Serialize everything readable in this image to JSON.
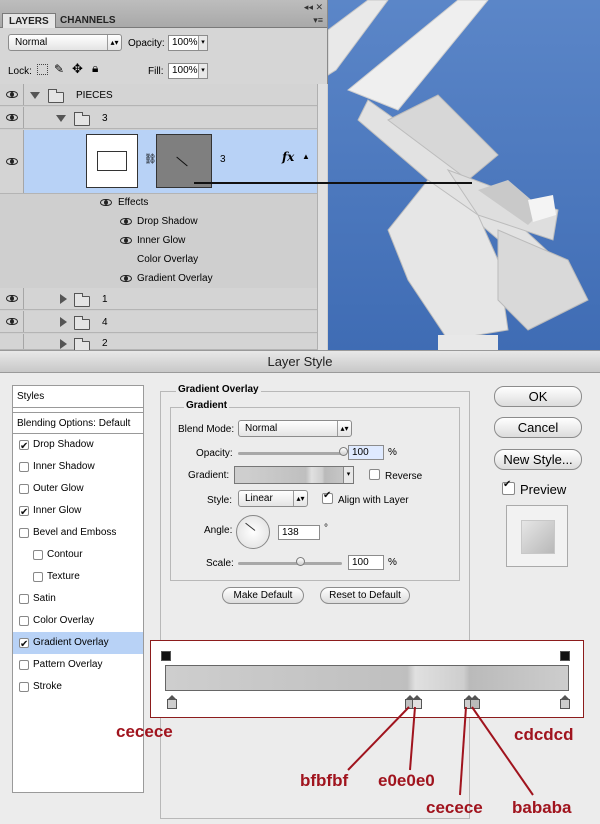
{
  "layers_panel": {
    "tabs": [
      "LAYERS",
      "CHANNELS"
    ],
    "controls": "◂◂ ✕",
    "menu": "▾≡",
    "blend_mode": "Normal",
    "opacity_label": "Opacity:",
    "opacity_value": "100%",
    "lock_label": "Lock:",
    "fill_label": "Fill:",
    "fill_value": "100%",
    "rows": [
      {
        "name": "PIECES"
      },
      {
        "name": "3"
      },
      {
        "name": "3"
      },
      {
        "name": "1"
      },
      {
        "name": "4"
      },
      {
        "name": "2"
      }
    ],
    "fx": "fx",
    "effects_label": "Effects",
    "effects": [
      "Drop Shadow",
      "Inner Glow",
      "Color Overlay",
      "Gradient Overlay"
    ]
  },
  "dialog": {
    "title": "Layer Style",
    "styles_header": "Styles",
    "blending_options": "Blending Options: Default",
    "style_items": [
      {
        "label": "Drop Shadow",
        "checked": true
      },
      {
        "label": "Inner Shadow",
        "checked": false
      },
      {
        "label": "Outer Glow",
        "checked": false
      },
      {
        "label": "Inner Glow",
        "checked": true
      },
      {
        "label": "Bevel and Emboss",
        "checked": false
      },
      {
        "label": "Contour",
        "checked": false
      },
      {
        "label": "Texture",
        "checked": false
      },
      {
        "label": "Satin",
        "checked": false
      },
      {
        "label": "Color Overlay",
        "checked": false
      },
      {
        "label": "Gradient Overlay",
        "checked": true
      },
      {
        "label": "Pattern Overlay",
        "checked": false
      },
      {
        "label": "Stroke",
        "checked": false
      }
    ],
    "section_title": "Gradient Overlay",
    "group_title": "Gradient",
    "blend_mode_label": "Blend Mode:",
    "blend_mode_value": "Normal",
    "opacity_label": "Opacity:",
    "opacity_value": "100",
    "opacity_unit": "%",
    "opacity_fraction": 1.0,
    "gradient_label": "Gradient:",
    "reverse_label": "Reverse",
    "style_label": "Style:",
    "style_value": "Linear",
    "align_label": "Align with Layer",
    "angle_label": "Angle:",
    "angle_value": "138",
    "angle_unit": "°",
    "scale_label": "Scale:",
    "scale_value": "100",
    "scale_unit": "%",
    "make_default": "Make Default",
    "reset_default": "Reset to Default",
    "ok": "OK",
    "cancel": "Cancel",
    "new_style": "New Style...",
    "preview_label": "Preview"
  },
  "gradient_stops": {
    "annotations": [
      "cecece",
      "bfbfbf",
      "e0e0e0",
      "cecece",
      "bababa",
      "cdcdcd"
    ],
    "colors": {
      "stop1": "#cecece",
      "stop2": "#bfbfbf",
      "stop3": "#e0e0e0",
      "stop4": "#cecece",
      "stop5": "#bababa",
      "stop6": "#cdcdcd"
    }
  },
  "colors": {
    "annotation_red": "#a0141e",
    "selection_blue": "#b8d2f6",
    "sky_blue": "#4f7ec3"
  }
}
